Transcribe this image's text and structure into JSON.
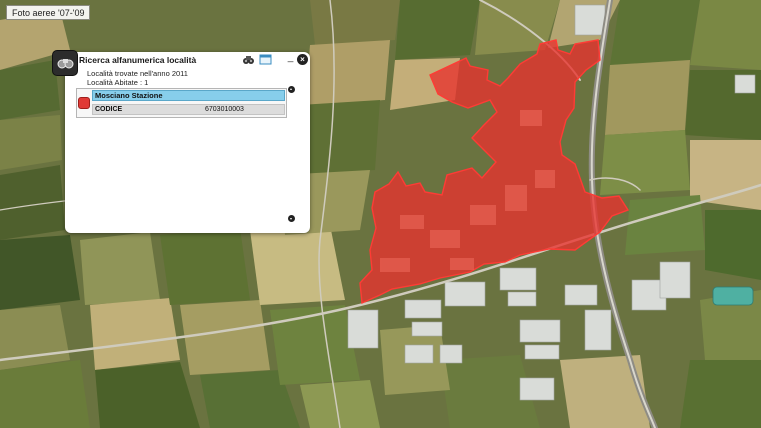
{
  "layer_badge": "Foto aeree '07-'09",
  "panel": {
    "title": "Ricerca alfanumerica località",
    "found_line": "Località trovate nell'anno 2011",
    "inhabited_line": "Località Abitate : 1",
    "minimize_glyph": "_",
    "close_glyph": "×",
    "result": {
      "name": "Mosciano Stazione",
      "field_label": "CODICE",
      "field_value": "6703010003",
      "swatch_color": "#e03a36"
    },
    "icons": [
      "binoculars-icon",
      "window-icon",
      "minimize-icon",
      "close-icon",
      "scroll-up-icon",
      "scroll-down-icon"
    ]
  },
  "map": {
    "highlight_color": "#e8322e"
  }
}
